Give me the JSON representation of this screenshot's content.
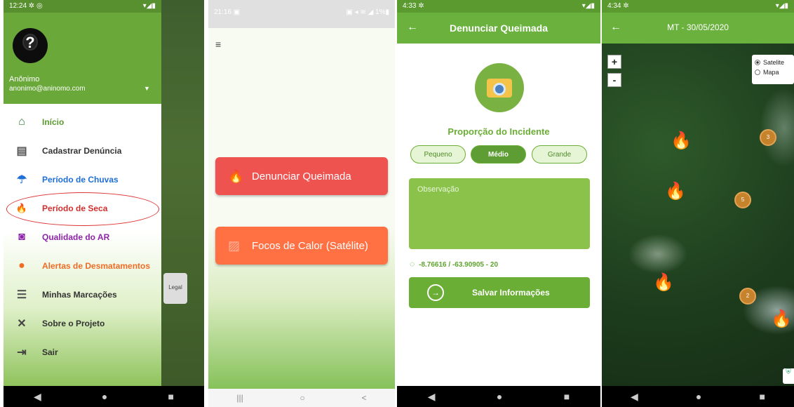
{
  "phone1": {
    "time": "12:24 ✲ ◎",
    "status_right": "▾◢▮",
    "user_name": "Anônimo",
    "user_email": "anonimo@aninomo.com",
    "avatar_glyph": "?",
    "menu": [
      {
        "label": "Início",
        "icon": "home-icon",
        "color": "#5a9a2f",
        "glyph": "⌂"
      },
      {
        "label": "Cadastrar Denúncia",
        "icon": "form-icon",
        "color": "#333333",
        "glyph": "▤"
      },
      {
        "label": "Período de Chuvas",
        "icon": "umbrella-icon",
        "color": "#1e6fd9",
        "glyph": "☂"
      },
      {
        "label": "Período de Seca",
        "icon": "fire-icon",
        "color": "#d32f2f",
        "glyph": "🔥"
      },
      {
        "label": "Qualidade do AR",
        "icon": "air-quality-icon",
        "color": "#8e24aa",
        "glyph": "◙"
      },
      {
        "label": "Alertas de Desmatamentos",
        "icon": "alert-icon",
        "color": "#ef6c27",
        "glyph": "●"
      },
      {
        "label": "Minhas Marcações",
        "icon": "list-icon",
        "color": "#333333",
        "glyph": "☰"
      },
      {
        "label": "Sobre o Projeto",
        "icon": "tools-icon",
        "color": "#333333",
        "glyph": "✕"
      },
      {
        "label": "Sair",
        "icon": "exit-icon",
        "color": "#333333",
        "glyph": "⇥"
      }
    ],
    "legal_label": "Legal"
  },
  "phone2": {
    "time": "21:16 ▣",
    "status_right": "▣ ◂ ≋ ◢ 1%▮",
    "btn_primary": "Denunciar Queimada",
    "btn_secondary": "Focos de Calor (Satélite)",
    "btn_primary_glyph": "🔥",
    "btn_secondary_glyph": "▨",
    "menu_glyph": "≡"
  },
  "phone3": {
    "time": "4:33 ✲",
    "status_right": "▾◢▮",
    "title": "Denunciar Queimada",
    "proportion_label": "Proporção do Incidente",
    "sizes": [
      "Pequeno",
      "Médio",
      "Grande"
    ],
    "selected_size": "Médio",
    "observation_placeholder": "Observação",
    "coordinates": "-8.76616 / -63.90905  - 20",
    "save_label": "Salvar Informações"
  },
  "phone4": {
    "time": "4:34 ✲",
    "status_right": "▾◢▮",
    "title": "MT - 30/05/2020",
    "zoom_in": "+",
    "zoom_out": "-",
    "layer_options": [
      "Satelite",
      "Mapa"
    ],
    "selected_layer": "Satelite",
    "clusters": [
      "3",
      "5",
      "2"
    ]
  },
  "nav": {
    "back": "◀",
    "home": "●",
    "recent": "■",
    "alt_recent": "|||",
    "alt_home": "○",
    "alt_back": "<"
  },
  "colors": {
    "green": "#6ab23d",
    "red": "#ef5350",
    "orange": "#ff7043"
  }
}
